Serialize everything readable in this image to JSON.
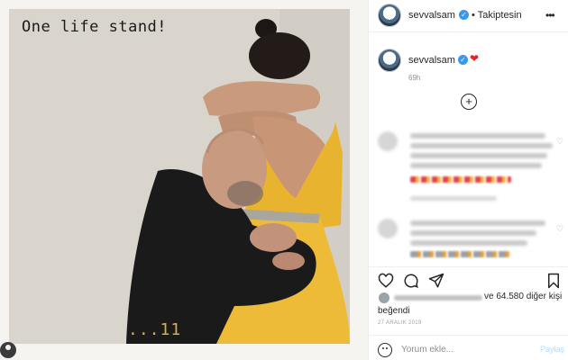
{
  "photo": {
    "caption": "One life stand!",
    "counter": "...11"
  },
  "header": {
    "username": "sevvalsam",
    "follow_status": "• Takiptesin",
    "more": "•••"
  },
  "caption": {
    "username": "sevvalsam",
    "emoji": "❤",
    "time_ago": "69h"
  },
  "comments_load_more": "+",
  "likes": {
    "text": "ve 64.580 diğer kişi",
    "liked_word": "beğendi"
  },
  "post_date": "27 ARALIK 2019",
  "comment_box": {
    "placeholder": "Yorum ekle...",
    "post_label": "Paylaş"
  },
  "icons": [
    "heart-icon",
    "comment-icon",
    "share-icon",
    "bookmark-icon",
    "emoji-icon",
    "more-icon",
    "verified-icon"
  ],
  "colors": {
    "verified": "#3897f0",
    "dress": "#e8b430",
    "post_button_disabled": "#b3dbff"
  }
}
